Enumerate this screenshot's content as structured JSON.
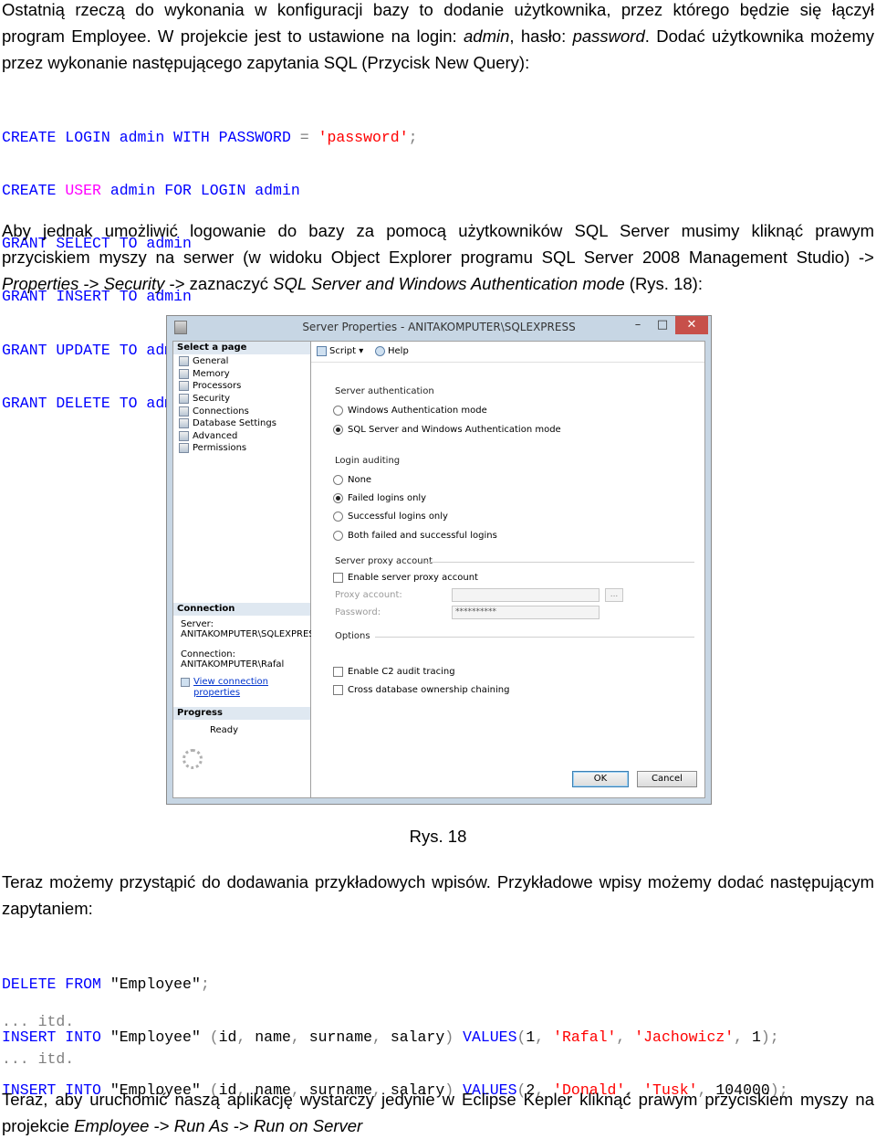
{
  "para1": {
    "lines": [
      "Ostatnią rzeczą do wykonania w konfiguracji bazy to dodanie użytkownika, przez którego będzie się łączył",
      [
        "program Employee. W projekcie jest to ustawione na login: ",
        "admin",
        ", hasło: ",
        "password",
        ". Dodać użytkownika możemy"
      ],
      "przez wykonanie następującego zapytania SQL (Przycisk New Query):"
    ]
  },
  "code1": [
    "CREATE LOGIN admin WITH PASSWORD = 'password';",
    "CREATE USER admin FOR LOGIN admin",
    "GRANT SELECT TO admin",
    "GRANT INSERT TO admin",
    "GRANT UPDATE TO admin",
    "GRANT DELETE TO admin"
  ],
  "para2": {
    "line1": "Aby jednak umożliwić logowanie do bazy za pomocą użytkowników SQL Server musimy kliknąć prawym",
    "line2": "przyciskiem myszy na serwer (w widoku Object Explorer programu SQL Server 2008 Management Studio) ->",
    "line3_parts": [
      "Properties",
      " -> ",
      "Security",
      " -> zaznaczyć ",
      "SQL Server and Windows Authentication mode",
      " (Rys. 18):"
    ]
  },
  "dialog": {
    "title": "Server Properties - ANITAKOMPUTER\\SQLEXPRESS",
    "close_glyph": "✕",
    "select_page_header": "Select a page",
    "pages": [
      "General",
      "Memory",
      "Processors",
      "Security",
      "Connections",
      "Database Settings",
      "Advanced",
      "Permissions"
    ],
    "connection_header": "Connection",
    "server_label": "Server:",
    "server_value": "ANITAKOMPUTER\\SQLEXPRES",
    "connection_label": "Connection:",
    "connection_value": "ANITAKOMPUTER\\Rafal",
    "view_connection_link": "View connection properties",
    "progress_header": "Progress",
    "progress_status": "Ready",
    "toolbar": {
      "script": "Script",
      "help": "Help"
    },
    "server_auth_group": "Server authentication",
    "auth_options": [
      {
        "label": "Windows Authentication mode",
        "selected": false
      },
      {
        "label": "SQL Server and Windows Authentication mode",
        "selected": true
      }
    ],
    "login_auditing_group": "Login auditing",
    "audit_options": [
      {
        "label": "None",
        "selected": false
      },
      {
        "label": "Failed logins only",
        "selected": true
      },
      {
        "label": "Successful logins only",
        "selected": false
      },
      {
        "label": "Both failed and successful logins",
        "selected": false
      }
    ],
    "proxy_group": "Server proxy account",
    "enable_proxy": "Enable server proxy account",
    "proxy_account_label": "Proxy account:",
    "password_label": "Password:",
    "password_value": "**********",
    "ellipsis": "...",
    "options_group": "Options",
    "option_c2": "Enable C2 audit tracing",
    "option_chaining": "Cross database ownership chaining",
    "ok_button": "OK",
    "cancel_button": "Cancel"
  },
  "caption": "Rys. 18",
  "para3": {
    "line1": "Teraz możemy przystąpić do dodawania przykładowych wpisów. Przykładowe wpisy możemy dodać następującym",
    "line2": "zapytaniem:"
  },
  "code2": [
    "DELETE FROM \"Employee\";",
    "INSERT INTO \"Employee\" (id, name, surname, salary) VALUES(1, 'Rafal', 'Jachowicz', 1);",
    "INSERT INTO \"Employee\" (id, name, surname, salary) VALUES(2, 'Donald', 'Tusk', 104000);"
  ],
  "itd1": "... itd.",
  "itd2": "... itd.",
  "para4": {
    "line1": "Teraz, aby uruchomić naszą aplikację wystarczy jedynie w Eclipse Kepler kliknąć prawym przyciskiem myszy na",
    "line2_parts": [
      "projekcie ",
      "Employee",
      " -> ",
      "Run As",
      " -> ",
      "Run on Server"
    ]
  }
}
